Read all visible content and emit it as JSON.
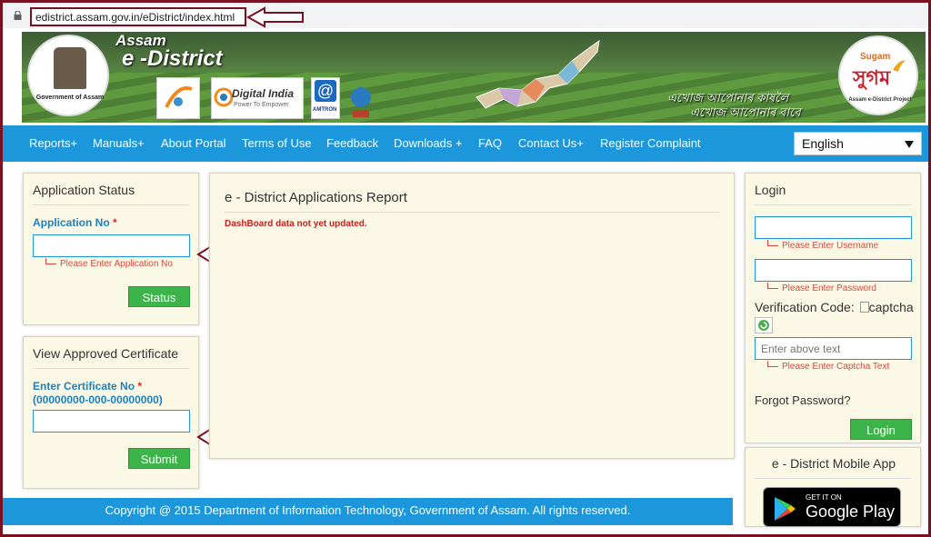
{
  "browser": {
    "url": "edistrict.assam.gov.in/eDistrict/index.html"
  },
  "banner": {
    "gov_label": "Government of Assam",
    "title_assam": "Assam",
    "title_edistrict": "e -District",
    "digital_india": "Digital India",
    "digital_india_sub": "Power To Empower",
    "amtron": "AMTRON",
    "tagline_line1": "এখোজ আপোনাৰ কাষলৈ",
    "tagline_line2": "এখোজ আপোনাৰ বাবে",
    "sugam_top": "Sugam",
    "sugam_main": "সুগম",
    "sugam_sub": "Assam e-District Project"
  },
  "nav": {
    "items": [
      "Reports+",
      "Manuals+",
      "About Portal",
      "Terms of Use",
      "Feedback",
      "Downloads +",
      "FAQ",
      "Contact Us+",
      "Register Complaint"
    ],
    "language": "English"
  },
  "app_status": {
    "title": "Application Status",
    "label": "Application No",
    "hint": "Please Enter Application No",
    "button": "Status"
  },
  "certificate": {
    "title": "View Approved Certificate",
    "label": "Enter Certificate No",
    "format": "(00000000-000-00000000)",
    "button": "Submit"
  },
  "report": {
    "title": "e - District Applications Report",
    "message": "DashBoard data not yet updated."
  },
  "login": {
    "title": "Login",
    "username_hint": "Please Enter Username",
    "password_hint": "Please Enter Password",
    "verification_label": "Verification Code:",
    "captcha_alt": "captcha",
    "captcha_placeholder": "Enter above text",
    "captcha_hint": "Please Enter Captcha Text",
    "forgot": "Forgot Password?",
    "button": "Login"
  },
  "mobile_app": {
    "title": "e - District Mobile App",
    "store_small": "GET IT ON",
    "store_big": "Google Play"
  },
  "footer": {
    "text": "Copyright @ 2015 Department of Information Technology, Government of Assam. All rights reserved."
  },
  "colors": {
    "nav_blue": "#1c97dc",
    "panel_bg": "#fbf8e6",
    "button_green": "#3cb44a",
    "annotation_maroon": "#7a1020"
  }
}
